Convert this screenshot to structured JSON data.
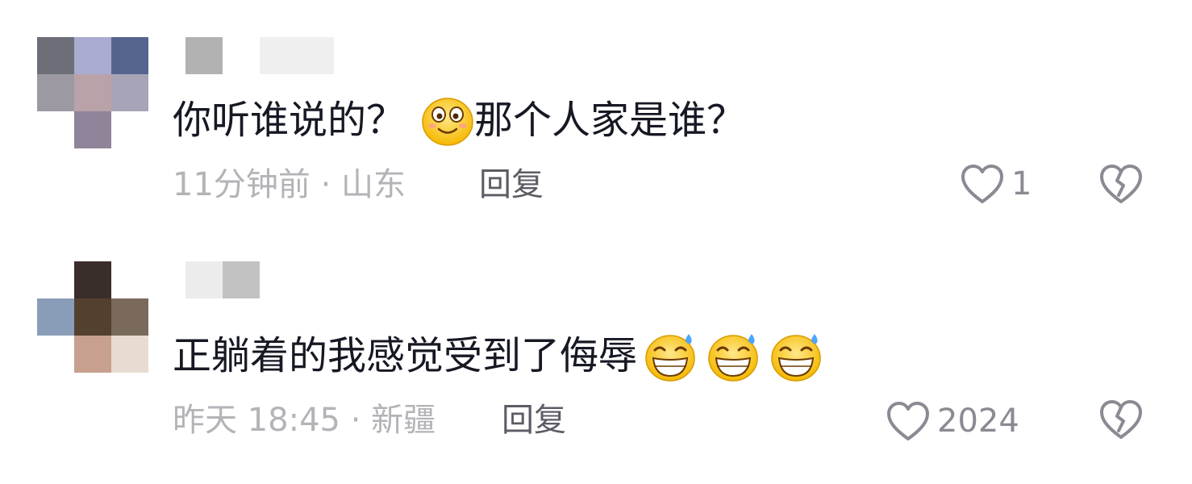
{
  "comments": [
    {
      "text": "你听谁说的？",
      "text_after": "那个人家是谁？",
      "emoji": [
        "smiling-face-emoji"
      ],
      "time_location": "11分钟前 · 山东",
      "reply_label": "回复",
      "likes": "1"
    },
    {
      "text": "正躺着的我感觉受到了侮辱",
      "text_after": "",
      "emoji": [
        "grinning-sweat-emoji",
        "grinning-sweat-emoji",
        "grinning-sweat-emoji"
      ],
      "time_location": "昨天 18:45 · 新疆",
      "reply_label": "回复",
      "likes": "2024"
    }
  ],
  "colors": {
    "text": "#161823",
    "meta": "#b3b3b8",
    "reply": "#5c5c66",
    "icon": "#8a8a93"
  }
}
